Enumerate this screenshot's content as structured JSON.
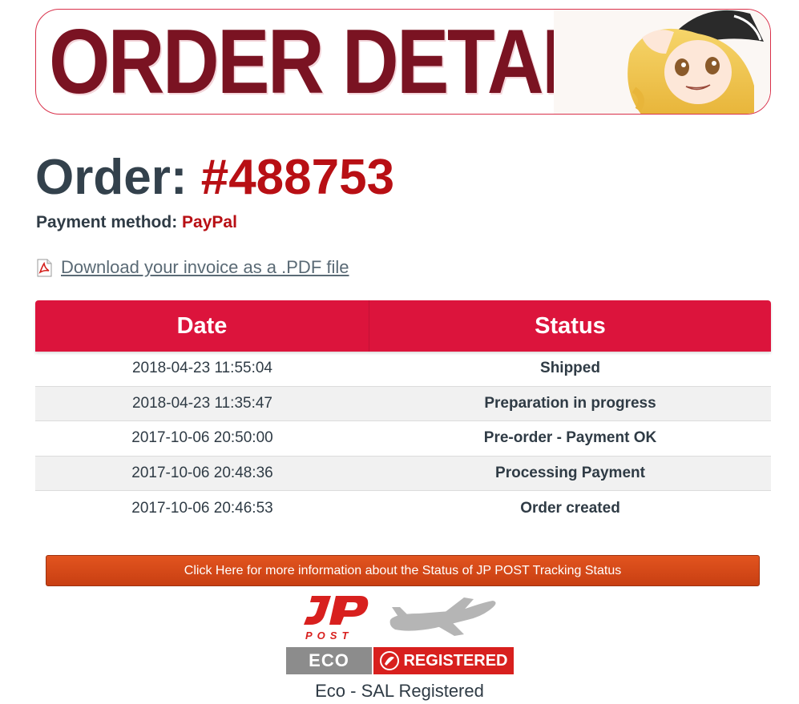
{
  "banner": {
    "title": "ORDER DETAIL",
    "art": "anime-character-illustration"
  },
  "order": {
    "prefix": "Order:",
    "number": "#488753"
  },
  "payment": {
    "label": "Payment method:",
    "value": "PayPal"
  },
  "invoice": {
    "icon": "pdf-file-icon",
    "link_text": "Download your invoice as a .PDF file"
  },
  "table": {
    "headers": {
      "date": "Date",
      "status": "Status"
    },
    "rows": [
      {
        "date": "2018-04-23 11:55:04",
        "status": "Shipped"
      },
      {
        "date": "2018-04-23 11:35:47",
        "status": "Preparation in progress"
      },
      {
        "date": "2017-10-06 20:50:00",
        "status": "Pre-order - Payment OK"
      },
      {
        "date": "2017-10-06 20:48:36",
        "status": "Processing Payment"
      },
      {
        "date": "2017-10-06 20:46:53",
        "status": "Order created"
      }
    ]
  },
  "tracking": {
    "button_label": "Click Here for more information about the Status of JP POST Tracking Status"
  },
  "shipping": {
    "logo_text": "JP",
    "logo_subtext": "POST",
    "badge_left": "ECO",
    "badge_right": "REGISTERED",
    "label": "Eco - SAL Registered"
  },
  "colors": {
    "accent_red": "#dc143c",
    "dark_red": "#b80f14",
    "button_orange": "#d9491a",
    "text_dark": "#2f3b45"
  }
}
